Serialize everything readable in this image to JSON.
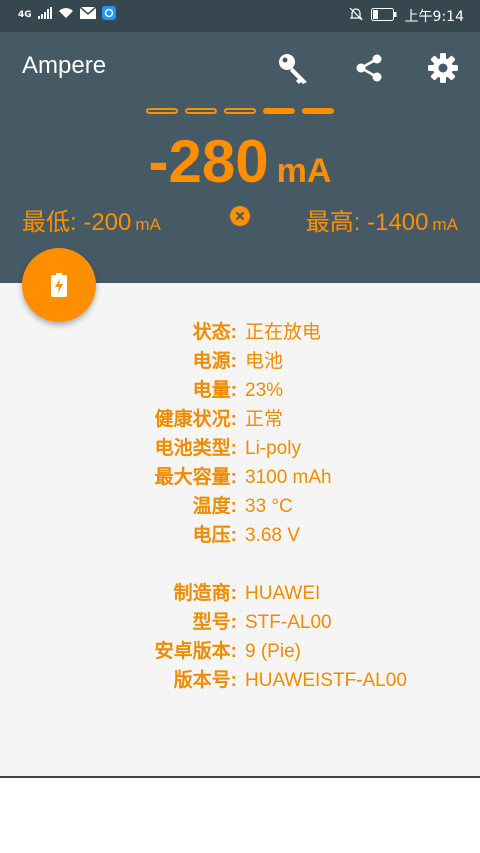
{
  "status_bar": {
    "network": "4G",
    "time": "上午9:14"
  },
  "app": {
    "title": "Ampere"
  },
  "meter": {
    "current_value": "-280",
    "current_unit": "mA",
    "min_label": "最低:",
    "min_value": "-200",
    "max_label": "最高:",
    "max_value": "-1400",
    "unit": "mA",
    "level_filled": 2,
    "level_total": 5
  },
  "colors": {
    "accent": "#ff8f00",
    "header": "#455a64",
    "statusbar": "#37474f"
  },
  "battery_info": [
    {
      "label": "状态:",
      "value": "正在放电"
    },
    {
      "label": "电源:",
      "value": "电池"
    },
    {
      "label": "电量:",
      "value": "23%"
    },
    {
      "label": "健康状况:",
      "value": "正常"
    },
    {
      "label": "电池类型:",
      "value": "Li-poly"
    },
    {
      "label": "最大容量:",
      "value": "3100 mAh"
    },
    {
      "label": "温度:",
      "value": "33 °C"
    },
    {
      "label": "电压:",
      "value": "3.68 V"
    }
  ],
  "device_info": [
    {
      "label": "制造商:",
      "value": "HUAWEI"
    },
    {
      "label": "型号:",
      "value": "STF-AL00"
    },
    {
      "label": "安卓版本:",
      "value": "9 (Pie)"
    },
    {
      "label": "版本号:",
      "value": "HUAWEISTF-AL00"
    }
  ]
}
